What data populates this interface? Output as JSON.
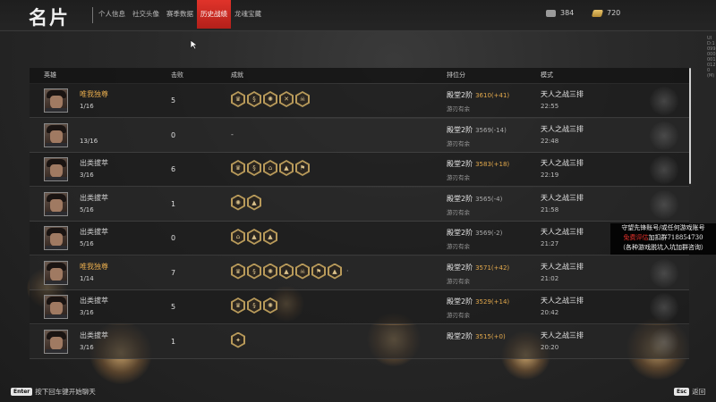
{
  "header": {
    "title": "名片",
    "tabs": [
      {
        "label": "个人信息",
        "active": false
      },
      {
        "label": "社交头像",
        "active": false
      },
      {
        "label": "赛季数据",
        "active": false
      },
      {
        "label": "历史战绩",
        "active": true
      },
      {
        "label": "龙魂宝藏",
        "active": false
      }
    ],
    "currency": [
      {
        "icon": "silver-coin-icon",
        "value": "384"
      },
      {
        "icon": "gold-ingot-icon",
        "value": "720"
      }
    ]
  },
  "table": {
    "columns": [
      "英雄",
      "击败",
      "成就",
      "排位分",
      "模式"
    ],
    "rows": [
      {
        "title": "唯我独尊",
        "title_color": "gold",
        "score": "1/16",
        "kills": "5",
        "achievements": [
          "crown-badge-icon",
          "scroll-badge-icon",
          "swirl-badge-icon",
          "swords-badge-icon",
          "skull-badge-icon"
        ],
        "rank": "殿堂2阶",
        "rank_score": "3610(+41)",
        "rank_positive": true,
        "rank_sub": "游刃有余",
        "mode": "天人之战三排",
        "time": "22:55"
      },
      {
        "title": "",
        "title_color": "normal",
        "score": "13/16",
        "kills": "0",
        "achievements": [],
        "no_achievement": "-",
        "rank": "殿堂2阶",
        "rank_score": "3569(-14)",
        "rank_positive": false,
        "rank_sub": "游刃有余",
        "mode": "天人之战三排",
        "time": "22:48"
      },
      {
        "title": "出类拔萃",
        "title_color": "normal",
        "score": "3/16",
        "kills": "6",
        "achievements": [
          "crown-badge-icon",
          "scroll-badge-icon",
          "gate-badge-icon",
          "mountain-badge-icon",
          "flag-badge-icon"
        ],
        "rank": "殿堂2阶",
        "rank_score": "3583(+18)",
        "rank_positive": true,
        "rank_sub": "游刃有余",
        "mode": "天人之战三排",
        "time": "22:19"
      },
      {
        "title": "出类拔萃",
        "title_color": "normal",
        "score": "5/16",
        "kills": "1",
        "achievements": [
          "swirl-badge-icon",
          "mountain-badge-icon"
        ],
        "rank": "殿堂2阶",
        "rank_score": "3565(-4)",
        "rank_positive": false,
        "rank_sub": "游刃有余",
        "mode": "天人之战三排",
        "time": "21:58"
      },
      {
        "title": "出类拔萃",
        "title_color": "normal",
        "score": "5/16",
        "kills": "0",
        "achievements": [
          "house-badge-icon",
          "mountain-badge-icon",
          "mountain-badge-icon"
        ],
        "rank": "殿堂2阶",
        "rank_score": "3569(-2)",
        "rank_positive": false,
        "rank_sub": "游刃有余",
        "mode": "天人之战三排",
        "time": "21:27"
      },
      {
        "title": "唯我独尊",
        "title_color": "gold",
        "score": "1/14",
        "kills": "7",
        "achievements": [
          "crown-badge-icon",
          "scroll-badge-icon",
          "swirl-badge-icon",
          "mountain-badge-icon",
          "skull-badge-icon",
          "flag-badge-icon",
          "mountain-badge-icon"
        ],
        "rank": "殿堂2阶",
        "rank_score": "3571(+42)",
        "rank_positive": true,
        "rank_sub": "游刃有余",
        "mode": "天人之战三排",
        "time": "21:02"
      },
      {
        "title": "出类拔萃",
        "title_color": "normal",
        "score": "3/16",
        "kills": "5",
        "achievements": [
          "crown-badge-icon",
          "scroll-badge-icon",
          "swirl-badge-icon"
        ],
        "rank": "殿堂2阶",
        "rank_score": "3529(+14)",
        "rank_positive": true,
        "rank_sub": "游刃有余",
        "mode": "天人之战三排",
        "time": "20:42"
      },
      {
        "title": "出类拔萃",
        "title_color": "normal",
        "score": "3/16",
        "kills": "1",
        "achievements": [
          "blade-badge-icon"
        ],
        "rank": "殿堂2阶",
        "rank_score": "3515(+0)",
        "rank_positive": true,
        "rank_sub": "",
        "mode": "天人之战三排",
        "time": "20:20"
      }
    ]
  },
  "side_text": "UID:10990000010120(M)",
  "promo": {
    "line1": "守望先锋账号/或任何游戏账号",
    "line2_red": "免费评估",
    "line2_white": "加扣群718854730",
    "line3": "（各种游戏脱坑入坑加群咨询）"
  },
  "footer": {
    "chat_key": "Enter",
    "chat_text": "按下回车键开始聊天",
    "back_key": "Esc",
    "back_text": "返回"
  },
  "colors": {
    "accent_red": "#d42a22",
    "gold_text": "#e3a94c",
    "badge_gold": "#b89a5a"
  }
}
